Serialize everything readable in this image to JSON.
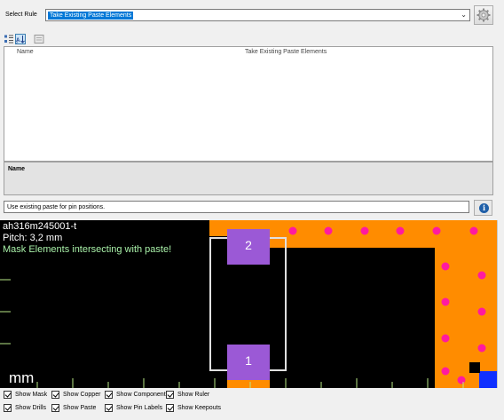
{
  "rule": {
    "label": "Select Rule",
    "selected": "Take Existing Paste Elements"
  },
  "icons": {
    "gear": "gear-icon",
    "chevron": "chevron-down-icon",
    "sort_category": "sort-category-icon",
    "sort_alpha": "sort-alphabetical-icon",
    "property_pages": "property-pages-icon",
    "info": "info-icon"
  },
  "property_grid": {
    "col_name": "Name",
    "col_value": "Take Existing Paste Elements"
  },
  "description": {
    "title": "Name"
  },
  "hint": {
    "text": "Use existing paste for pin positions."
  },
  "info_glyph": "i",
  "preview": {
    "part_name": "ah316m245001-t",
    "pitch": "Pitch: 3,2 mm",
    "status": "Mask Elements intersecting with paste!",
    "unit": "mm",
    "pad_top_label": "2",
    "pad_bottom_label": "1",
    "colors": {
      "background": "#000000",
      "copper_area": "#ff8c00",
      "drill_dots": "#ff1aa0",
      "pad": "#9b59d6",
      "outline": "#e0e0e0",
      "ruler": "#b8e986",
      "blue": "#1030ff"
    }
  },
  "checkboxes": [
    {
      "label": "Show Mask",
      "checked": true
    },
    {
      "label": "Show Copper",
      "checked": true
    },
    {
      "label": "Show Component",
      "checked": true
    },
    {
      "label": "Show Ruler",
      "checked": true
    },
    {
      "label": "Show Drills",
      "checked": true
    },
    {
      "label": "Show Paste",
      "checked": true
    },
    {
      "label": "Show Pin Labels",
      "checked": true
    },
    {
      "label": "Show Keepouts",
      "checked": true
    }
  ]
}
